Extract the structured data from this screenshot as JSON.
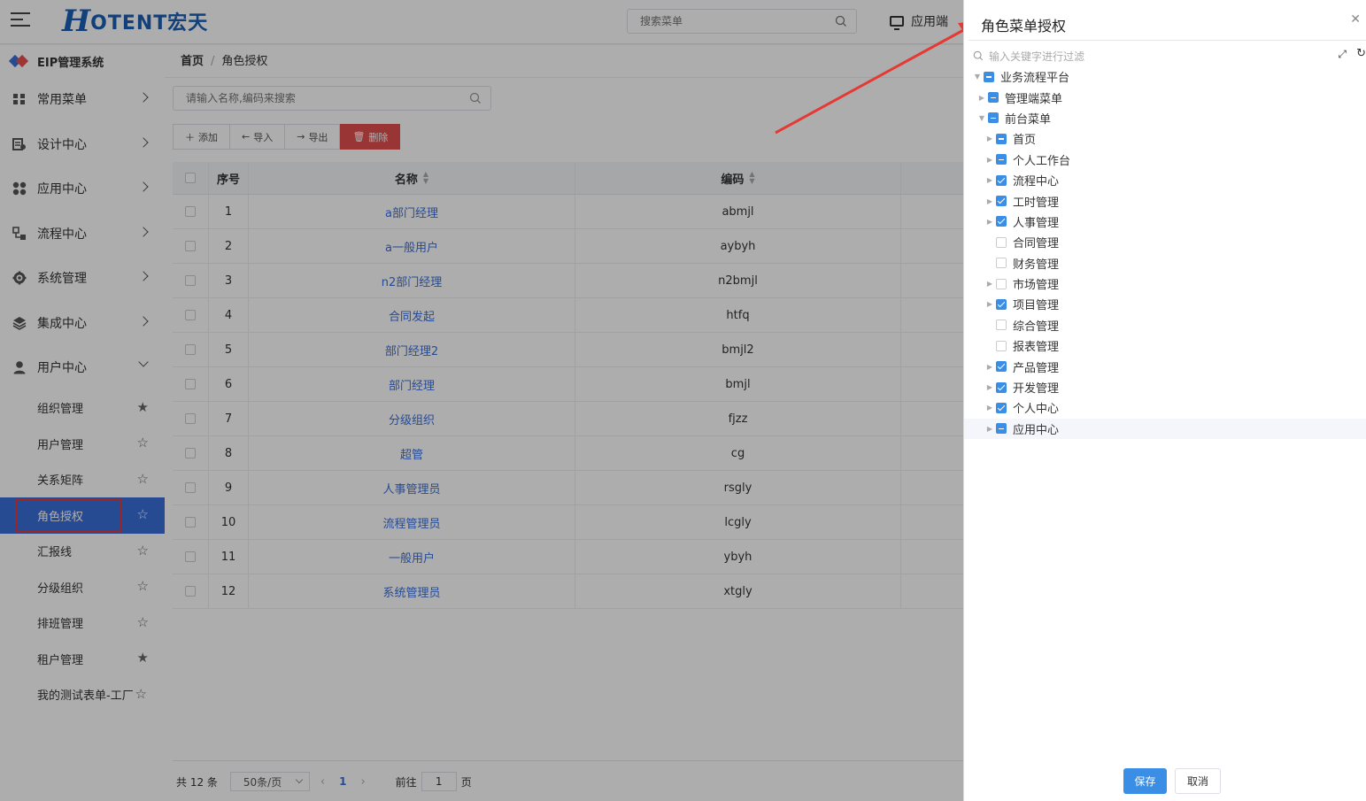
{
  "header": {
    "logo_h": "H",
    "logo_text": "OTENT宏天",
    "search_placeholder": "搜索菜单",
    "app_label": "应用端"
  },
  "sidebar": {
    "brand": "EIP管理系统",
    "menus": [
      {
        "label": "常用菜单",
        "icon": "grid-icon"
      },
      {
        "label": "设计中心",
        "icon": "design-icon"
      },
      {
        "label": "应用中心",
        "icon": "apps-icon"
      },
      {
        "label": "流程中心",
        "icon": "flow-icon"
      },
      {
        "label": "系统管理",
        "icon": "gear-icon"
      },
      {
        "label": "集成中心",
        "icon": "layers-icon"
      },
      {
        "label": "用户中心",
        "icon": "user-icon"
      }
    ],
    "sub_items": [
      {
        "label": "组织管理",
        "starred": true
      },
      {
        "label": "用户管理",
        "starred": false
      },
      {
        "label": "关系矩阵",
        "starred": false
      },
      {
        "label": "角色授权",
        "starred": false,
        "active": true
      },
      {
        "label": "汇报线",
        "starred": false
      },
      {
        "label": "分级组织",
        "starred": false
      },
      {
        "label": "排班管理",
        "starred": false
      },
      {
        "label": "租户管理",
        "starred": true
      },
      {
        "label": "我的测试表单-工厂",
        "starred": false
      }
    ]
  },
  "breadcrumb": {
    "home": "首页",
    "sep": "/",
    "current": "角色授权"
  },
  "main": {
    "search_placeholder": "请输入名称,编码来搜索",
    "toolbar": {
      "add": "添加",
      "import": "导入",
      "export": "导出",
      "delete": "删除"
    },
    "table": {
      "headers": {
        "no": "序号",
        "name": "名称",
        "code": "编码"
      },
      "rows": [
        {
          "no": "1",
          "name": "a部门经理",
          "code": "abmjl"
        },
        {
          "no": "2",
          "name": "a一般用户",
          "code": "aybyh"
        },
        {
          "no": "3",
          "name": "n2部门经理",
          "code": "n2bmjl"
        },
        {
          "no": "4",
          "name": "合同发起",
          "code": "htfq"
        },
        {
          "no": "5",
          "name": "部门经理2",
          "code": "bmjl2"
        },
        {
          "no": "6",
          "name": "部门经理",
          "code": "bmjl"
        },
        {
          "no": "7",
          "name": "分级组织",
          "code": "fjzz"
        },
        {
          "no": "8",
          "name": "超管",
          "code": "cg"
        },
        {
          "no": "9",
          "name": "人事管理员",
          "code": "rsgly"
        },
        {
          "no": "10",
          "name": "流程管理员",
          "code": "lcgly"
        },
        {
          "no": "11",
          "name": "一般用户",
          "code": "ybyh"
        },
        {
          "no": "12",
          "name": "系统管理员",
          "code": "xtgly"
        }
      ]
    },
    "pager": {
      "total": "共 12 条",
      "page_size": "50条/页",
      "page": "1",
      "goto_prefix": "前往",
      "goto_value": "1",
      "goto_suffix": "页"
    }
  },
  "drawer": {
    "title": "角色菜单授权",
    "filter_placeholder": "输入关键字进行过滤",
    "tree": [
      {
        "label": "业务流程平台",
        "level": 0,
        "state": "partial",
        "expand": "open"
      },
      {
        "label": "管理端菜单",
        "level": 1,
        "state": "partial",
        "expand": "closed"
      },
      {
        "label": "前台菜单",
        "level": 1,
        "state": "partial",
        "expand": "open"
      },
      {
        "label": "首页",
        "level": 2,
        "state": "partial",
        "expand": "closed"
      },
      {
        "label": "个人工作台",
        "level": 2,
        "state": "partial",
        "expand": "closed"
      },
      {
        "label": "流程中心",
        "level": 2,
        "state": "checked",
        "expand": "closed"
      },
      {
        "label": "工时管理",
        "level": 2,
        "state": "checked",
        "expand": "closed"
      },
      {
        "label": "人事管理",
        "level": 2,
        "state": "checked",
        "expand": "closed"
      },
      {
        "label": "合同管理",
        "level": 2,
        "state": "none",
        "expand": "leaf"
      },
      {
        "label": "财务管理",
        "level": 2,
        "state": "none",
        "expand": "leaf"
      },
      {
        "label": "市场管理",
        "level": 2,
        "state": "none",
        "expand": "closed"
      },
      {
        "label": "项目管理",
        "level": 2,
        "state": "checked",
        "expand": "closed"
      },
      {
        "label": "综合管理",
        "level": 2,
        "state": "none",
        "expand": "leaf"
      },
      {
        "label": "报表管理",
        "level": 2,
        "state": "none",
        "expand": "leaf"
      },
      {
        "label": "产品管理",
        "level": 2,
        "state": "checked",
        "expand": "closed"
      },
      {
        "label": "开发管理",
        "level": 2,
        "state": "checked",
        "expand": "closed"
      },
      {
        "label": "个人中心",
        "level": 2,
        "state": "checked",
        "expand": "closed"
      },
      {
        "label": "应用中心",
        "level": 2,
        "state": "partial",
        "expand": "closed",
        "highlight": true
      }
    ],
    "save": "保存",
    "cancel": "取消"
  },
  "colors": {
    "primary": "#3a6fd8",
    "danger": "#e44f4f",
    "annotation": "#e53935"
  }
}
